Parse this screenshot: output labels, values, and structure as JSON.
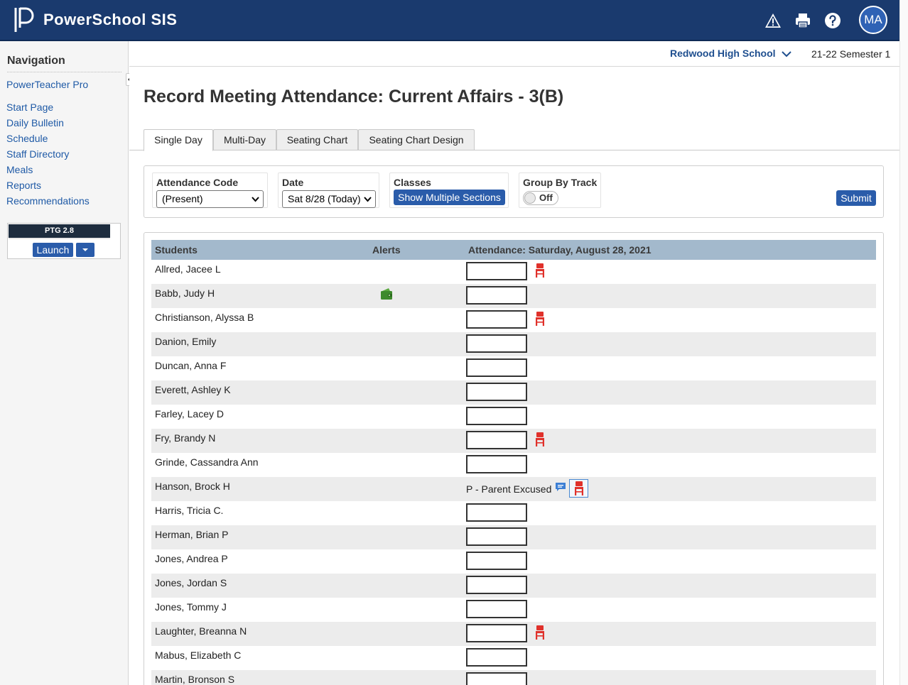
{
  "header": {
    "app_title": "PowerSchool SIS",
    "user_initials": "MA",
    "icons": [
      "alert-triangle-icon",
      "printer-icon",
      "help-icon"
    ]
  },
  "sidebar": {
    "title": "Navigation",
    "links": [
      "PowerTeacher Pro",
      "Start Page",
      "Daily Bulletin",
      "Schedule",
      "Staff Directory",
      "Meals",
      "Reports",
      "Recommendations"
    ],
    "ptg_label": "PTG 2.8",
    "launch_label": "Launch"
  },
  "context": {
    "school": "Redwood High School",
    "term": "21-22 Semester 1"
  },
  "page_title": "Record Meeting Attendance: Current Affairs - 3(B)",
  "tabs": [
    {
      "label": "Single Day",
      "active": true
    },
    {
      "label": "Multi-Day",
      "active": false
    },
    {
      "label": "Seating Chart",
      "active": false
    },
    {
      "label": "Seating Chart Design",
      "active": false
    }
  ],
  "filters": {
    "attendance_code_label": "Attendance Code",
    "attendance_code_value": "(Present)",
    "date_label": "Date",
    "date_value": "Sat 8/28 (Today)",
    "classes_label": "Classes",
    "show_sections_label": "Show Multiple Sections",
    "group_by_label": "Group By Track",
    "toggle_label": "Off",
    "submit_label": "Submit"
  },
  "table": {
    "col_students": "Students",
    "col_alerts": "Alerts",
    "col_attendance": "Attendance: Saturday, August 28, 2021",
    "rows": [
      {
        "name": "Allred, Jacee L",
        "chair": true,
        "alert": false,
        "status": ""
      },
      {
        "name": "Babb, Judy H",
        "chair": false,
        "alert": true,
        "status": ""
      },
      {
        "name": "Christianson, Alyssa B",
        "chair": true,
        "alert": false,
        "status": ""
      },
      {
        "name": "Danion, Emily",
        "chair": false,
        "alert": false,
        "status": ""
      },
      {
        "name": "Duncan, Anna F",
        "chair": false,
        "alert": false,
        "status": ""
      },
      {
        "name": "Everett, Ashley K",
        "chair": false,
        "alert": false,
        "status": ""
      },
      {
        "name": "Farley, Lacey D",
        "chair": false,
        "alert": false,
        "status": ""
      },
      {
        "name": "Fry, Brandy N",
        "chair": true,
        "alert": false,
        "status": ""
      },
      {
        "name": "Grinde, Cassandra Ann",
        "chair": false,
        "alert": false,
        "status": ""
      },
      {
        "name": "Hanson, Brock H",
        "chair": false,
        "alert": false,
        "status": "P - Parent Excused"
      },
      {
        "name": "Harris, Tricia C.",
        "chair": false,
        "alert": false,
        "status": ""
      },
      {
        "name": "Herman, Brian P",
        "chair": false,
        "alert": false,
        "status": ""
      },
      {
        "name": "Jones, Andrea P",
        "chair": false,
        "alert": false,
        "status": ""
      },
      {
        "name": "Jones, Jordan S",
        "chair": false,
        "alert": false,
        "status": ""
      },
      {
        "name": "Jones, Tommy J",
        "chair": false,
        "alert": false,
        "status": ""
      },
      {
        "name": "Laughter, Breanna N",
        "chair": true,
        "alert": false,
        "status": ""
      },
      {
        "name": "Mabus, Elizabeth C",
        "chair": false,
        "alert": false,
        "status": ""
      },
      {
        "name": "Martin, Bronson S",
        "chair": false,
        "alert": false,
        "status": ""
      }
    ]
  },
  "colors": {
    "header_bg": "#1a3a6e",
    "link": "#1f5aa6",
    "button": "#2a5caa",
    "table_header": "#a3b9cc",
    "chair_red": "#e0312b",
    "alert_green": "#3d8a2c"
  }
}
